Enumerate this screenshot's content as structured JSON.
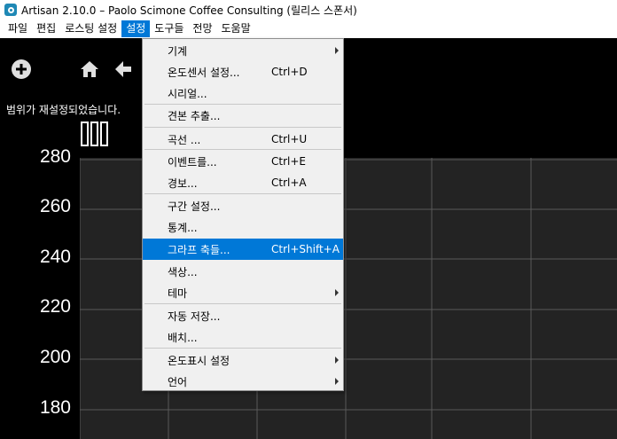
{
  "window": {
    "title": "Artisan 2.10.0 – Paolo Scimone Coffee Consulting (릴리스 스폰서)",
    "icon": "artisan-app-icon"
  },
  "menubar": {
    "items": [
      {
        "label": "파일"
      },
      {
        "label": "편집"
      },
      {
        "label": "로스팅 설정"
      },
      {
        "label": "설정",
        "active": true
      },
      {
        "label": "도구들"
      },
      {
        "label": "전망"
      },
      {
        "label": "도움말"
      }
    ]
  },
  "toolbar": {
    "icons": [
      "add-circle-icon",
      "home-icon",
      "back-arrow-icon"
    ]
  },
  "status": {
    "message": "범위가 재설정되었습니다."
  },
  "chart_data": {
    "type": "line",
    "y_ticks": [
      "280",
      "260",
      "240",
      "220",
      "200",
      "180"
    ],
    "grid": true,
    "series": []
  },
  "settings_menu": {
    "items": [
      {
        "label": "기계",
        "shortcut": "",
        "submenu": true
      },
      {
        "label": "온도센서 설정...",
        "shortcut": "Ctrl+D",
        "submenu": false
      },
      {
        "label": "시리얼...",
        "shortcut": "",
        "submenu": false
      },
      {
        "label": "견본 추출...",
        "shortcut": "",
        "submenu": false
      },
      {
        "label": "곡선 ...",
        "shortcut": "Ctrl+U",
        "submenu": false
      },
      {
        "label": "이벤트를...",
        "shortcut": "Ctrl+E",
        "submenu": false
      },
      {
        "label": "경보...",
        "shortcut": "Ctrl+A",
        "submenu": false
      },
      {
        "label": "구간 설정...",
        "shortcut": "",
        "submenu": false
      },
      {
        "label": "통계...",
        "shortcut": "",
        "submenu": false
      },
      {
        "label": "그라프 축들...",
        "shortcut": "Ctrl+Shift+A",
        "submenu": false,
        "highlighted": true
      },
      {
        "label": "색상...",
        "shortcut": "",
        "submenu": false
      },
      {
        "label": "테마",
        "shortcut": "",
        "submenu": true
      },
      {
        "label": "자동 저장...",
        "shortcut": "",
        "submenu": false
      },
      {
        "label": "배치...",
        "shortcut": "",
        "submenu": false
      },
      {
        "label": "온도표시 설정",
        "shortcut": "",
        "submenu": true
      },
      {
        "label": "언어",
        "shortcut": "",
        "submenu": true
      }
    ]
  },
  "colors": {
    "menu_highlight": "#0078d7",
    "plot_background": "#232323",
    "grid_line": "#5a5a5a",
    "canvas_background": "#000000"
  }
}
